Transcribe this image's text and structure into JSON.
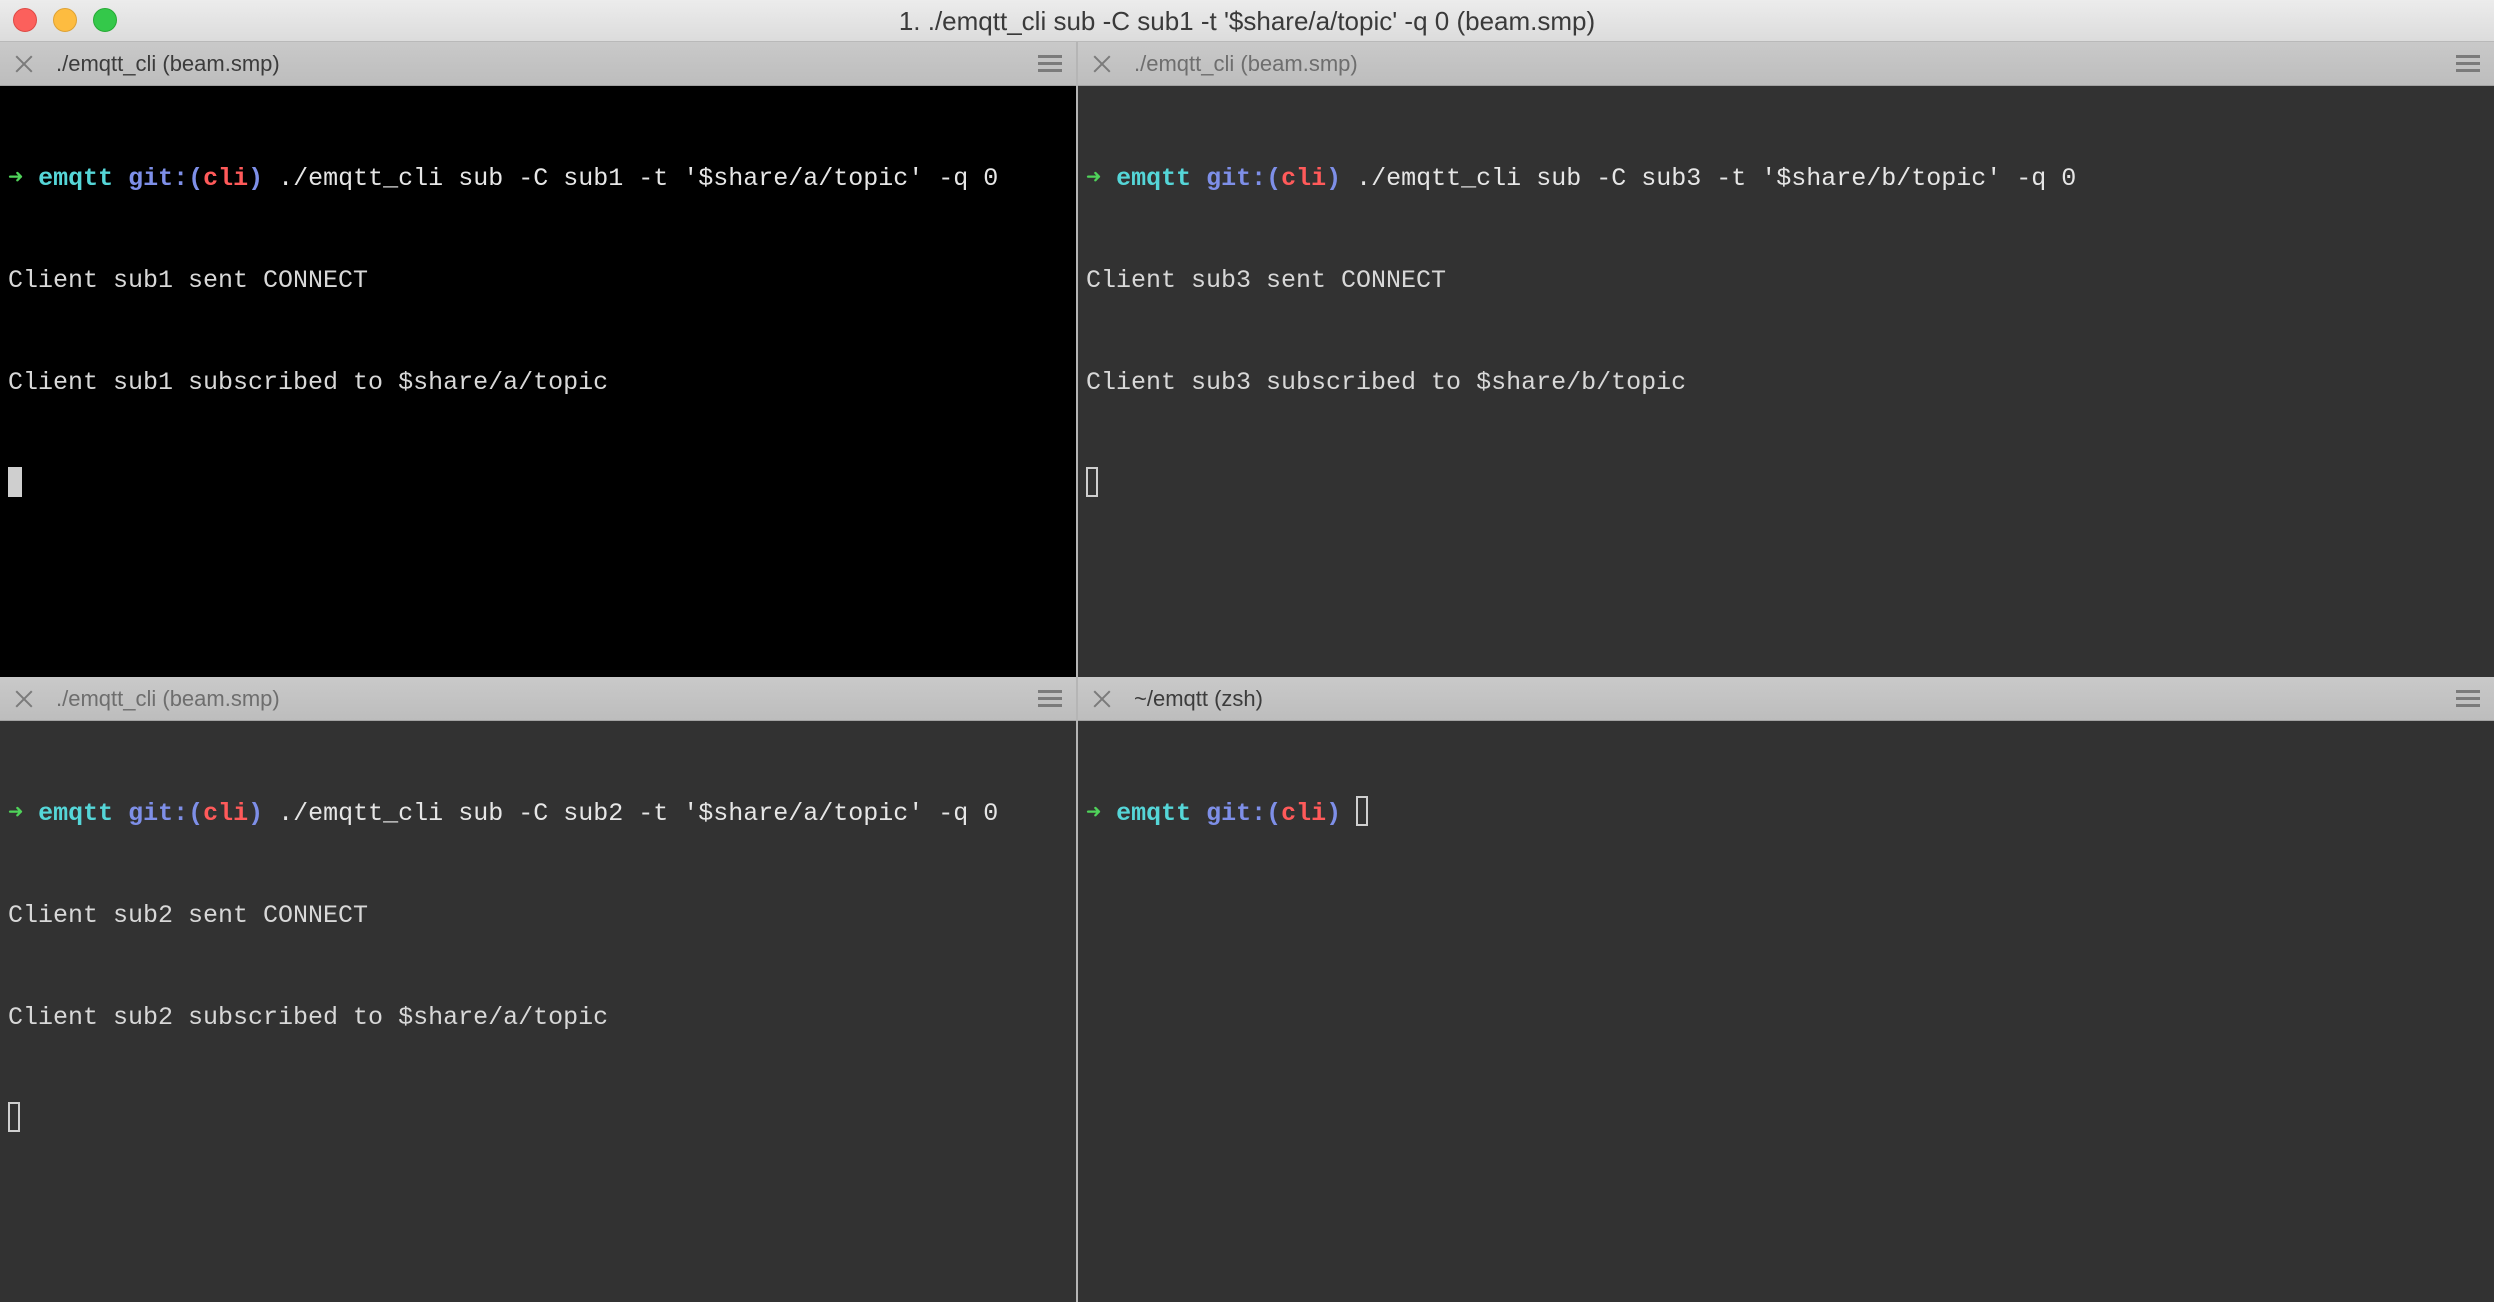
{
  "window": {
    "title": "1. ./emqtt_cli sub -C sub1 -t '$share/a/topic' -q 0 (beam.smp)"
  },
  "panes": [
    {
      "tab_title": "./emqtt_cli (beam.smp)",
      "prompt": {
        "arrow": "➜",
        "dir": "emqtt",
        "git": "git:(",
        "branch": "cli",
        "git_close": ")"
      },
      "command": " ./emqtt_cli sub -C sub1 -t '$share/a/topic' -q 0",
      "output": [
        "Client sub1 sent CONNECT",
        "Client sub1 subscribed to $share/a/topic"
      ]
    },
    {
      "tab_title": "./emqtt_cli (beam.smp)",
      "prompt": {
        "arrow": "➜",
        "dir": "emqtt",
        "git": "git:(",
        "branch": "cli",
        "git_close": ")"
      },
      "command": " ./emqtt_cli sub -C sub3 -t '$share/b/topic' -q 0",
      "output": [
        "Client sub3 sent CONNECT",
        "Client sub3 subscribed to $share/b/topic"
      ]
    },
    {
      "tab_title": "./emqtt_cli (beam.smp)",
      "prompt": {
        "arrow": "➜",
        "dir": "emqtt",
        "git": "git:(",
        "branch": "cli",
        "git_close": ")"
      },
      "command": " ./emqtt_cli sub -C sub2 -t '$share/a/topic' -q 0",
      "output": [
        "Client sub2 sent CONNECT",
        "Client sub2 subscribed to $share/a/topic"
      ]
    },
    {
      "tab_title": "~/emqtt (zsh)",
      "prompt": {
        "arrow": "➜",
        "dir": "emqtt",
        "git": "git:(",
        "branch": "cli",
        "git_close": ")"
      },
      "command": " ",
      "output": []
    }
  ],
  "colors": {
    "active_pane_bg": "#000000",
    "inactive_pane_bg": "#323232",
    "prompt_arrow": "#4fd35a",
    "prompt_dir": "#55d6d8",
    "prompt_git": "#7e8fe8",
    "prompt_branch": "#ff5a5a"
  },
  "icons": {
    "tab_close": "close-icon",
    "tab_menu": "hamburger-menu-icon"
  }
}
